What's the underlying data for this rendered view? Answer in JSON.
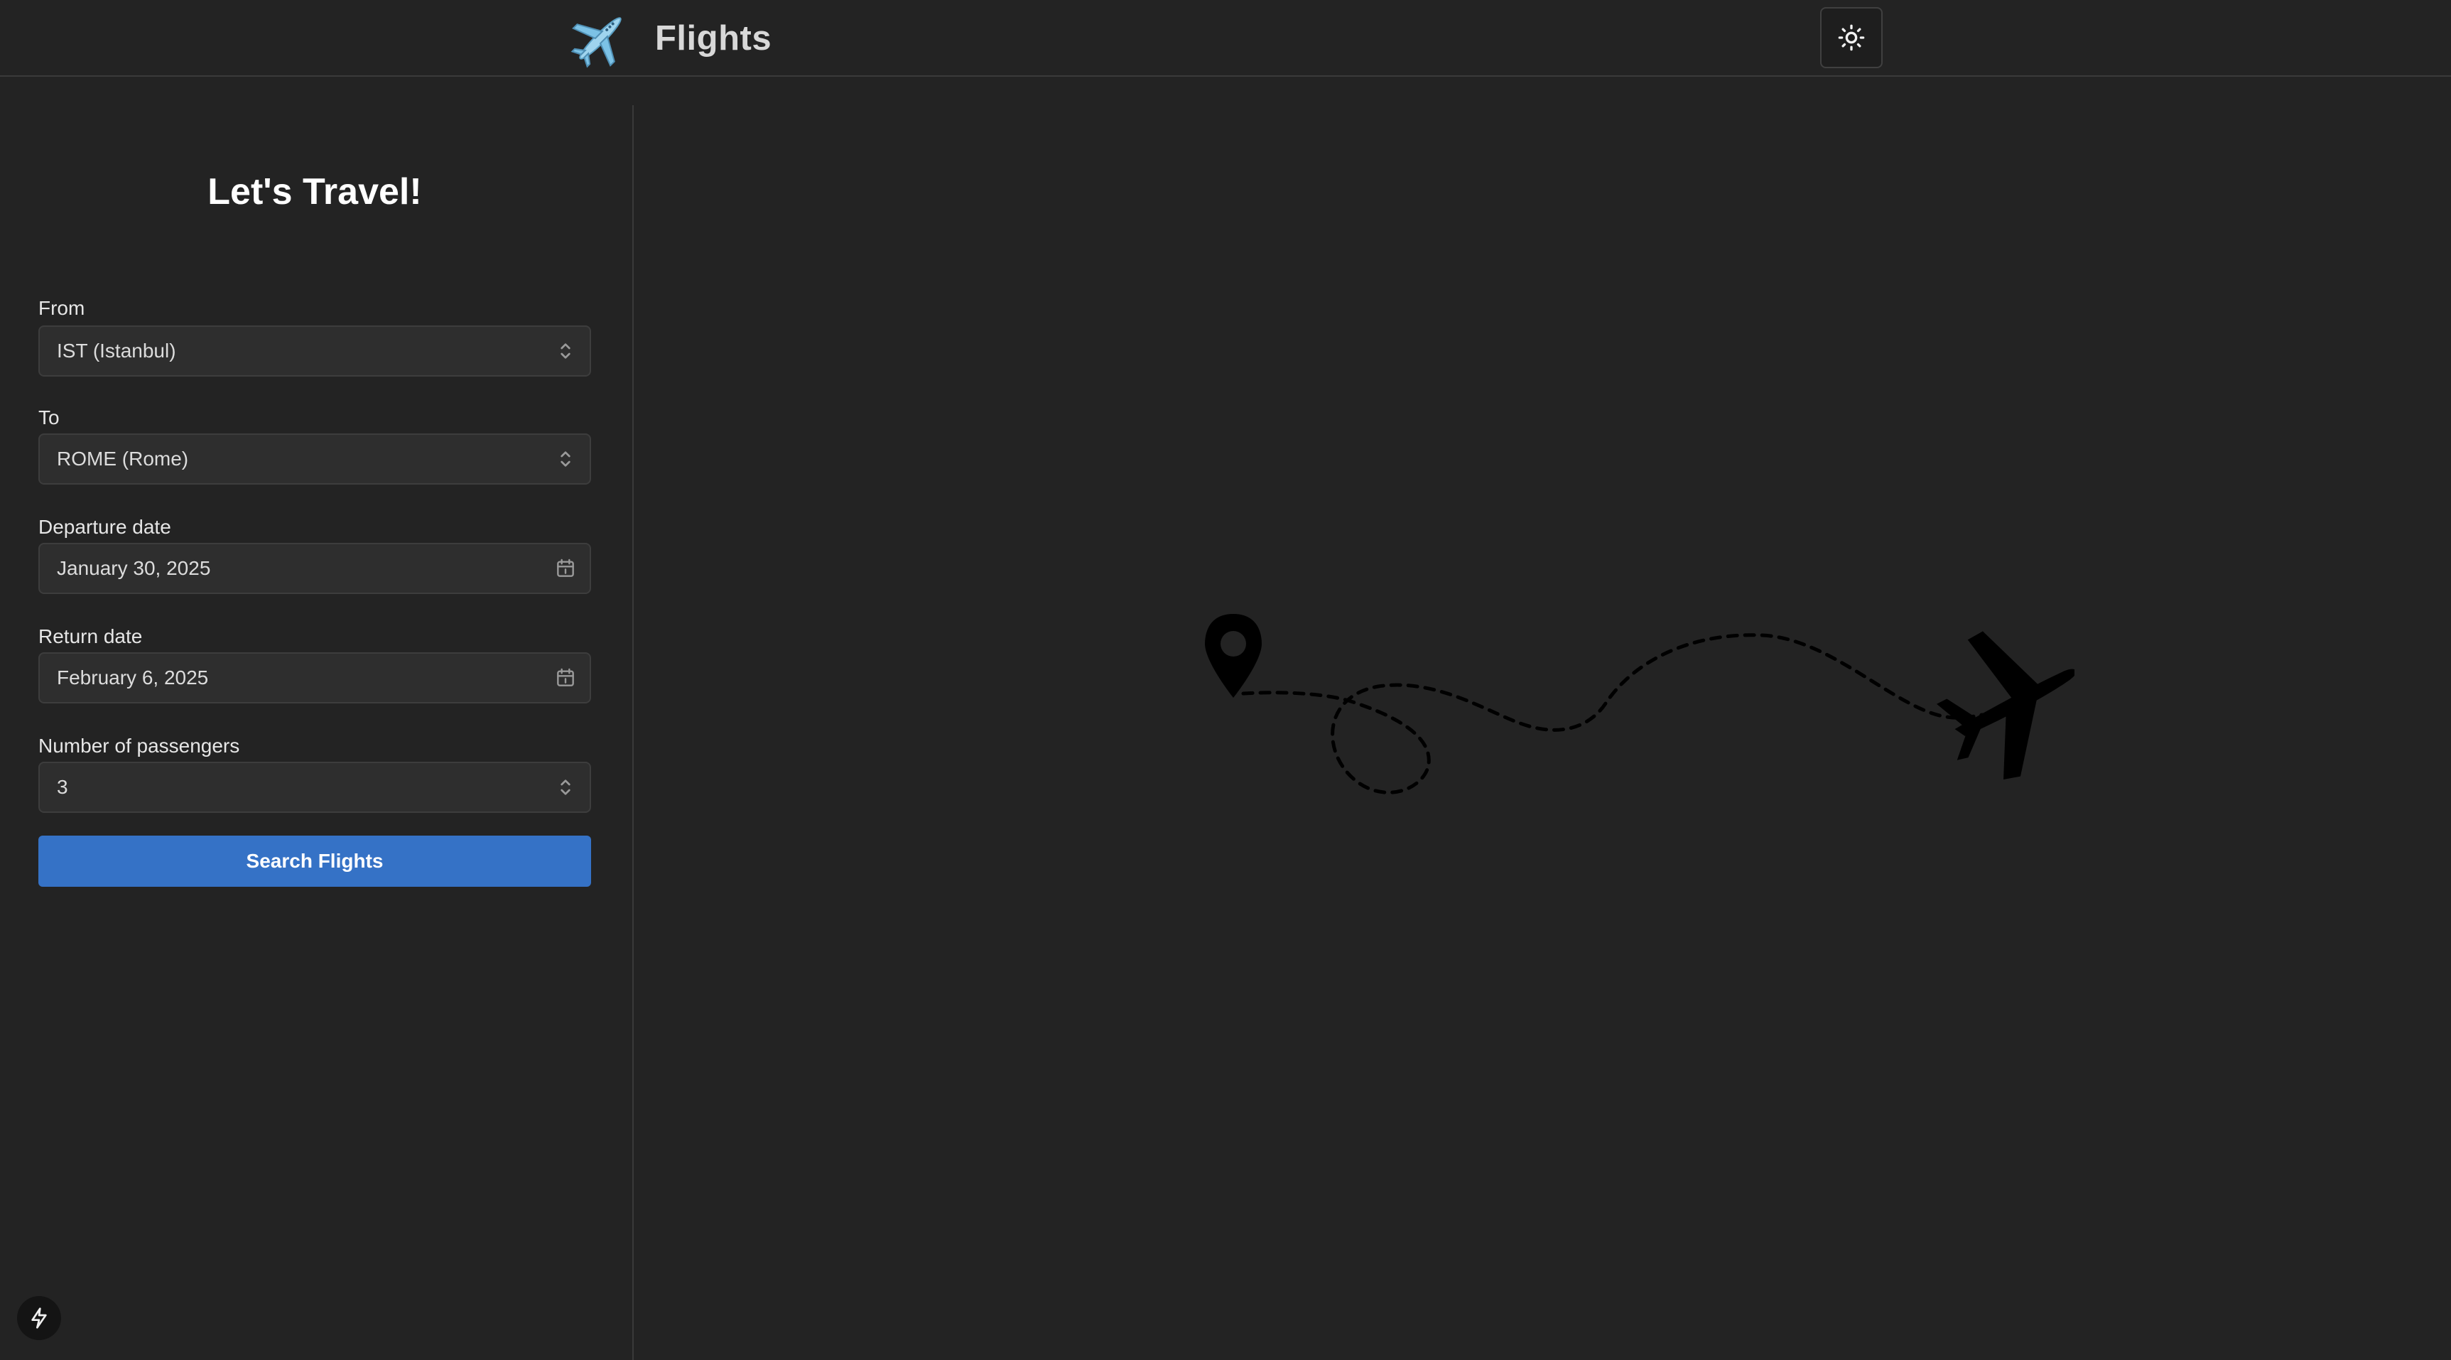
{
  "header": {
    "title": "Flights",
    "logo_icon": "airplane-emoji-icon",
    "theme_toggle_icon": "sun-icon"
  },
  "form": {
    "title": "Let's Travel!",
    "from": {
      "label": "From",
      "value": "IST (Istanbul)",
      "icon": "chevron-up-down-icon"
    },
    "to": {
      "label": "To",
      "value": "ROME (Rome)",
      "icon": "chevron-up-down-icon"
    },
    "departure": {
      "label": "Departure date",
      "value": "January 30, 2025",
      "icon": "calendar-icon"
    },
    "return": {
      "label": "Return date",
      "value": "February 6, 2025",
      "icon": "calendar-icon"
    },
    "passengers": {
      "label": "Number of passengers",
      "value": "3",
      "icon": "chevron-up-down-icon"
    },
    "submit_label": "Search Flights"
  },
  "footer": {
    "badge_icon": "lightning-bolt-icon"
  },
  "colors": {
    "background": "#232323",
    "accent": "#3572c6",
    "field_bg": "#2e2e2e",
    "border": "#3a3a3a"
  }
}
